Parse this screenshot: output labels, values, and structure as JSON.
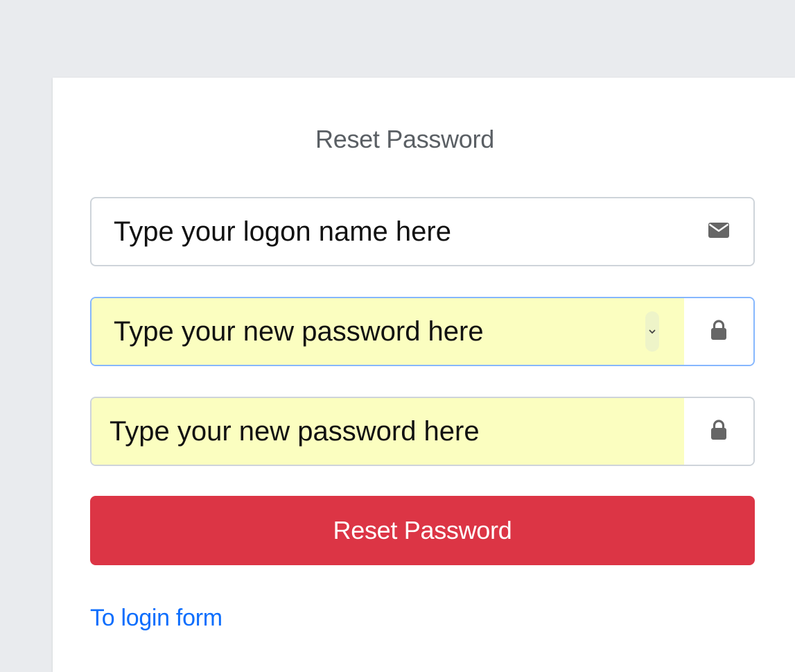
{
  "form": {
    "title": "Reset Password",
    "logon_field": {
      "value": "Type your logon name here",
      "icon": "envelope-icon"
    },
    "new_password_field": {
      "value": "Type your new password here",
      "icon": "lock-icon",
      "autofilled": true,
      "focused": true
    },
    "confirm_password_field": {
      "value": "Type your new password here",
      "icon": "lock-icon",
      "autofilled": true
    },
    "submit_label": "Reset Password",
    "back_link": "To login form"
  },
  "colors": {
    "background": "#e9ebee",
    "card": "#ffffff",
    "title_text": "#5a5f64",
    "autofill": "#fbfec0",
    "focus_border": "#86b7fe",
    "button": "#dc3545",
    "link": "#0d6efd",
    "icon": "#666666"
  }
}
